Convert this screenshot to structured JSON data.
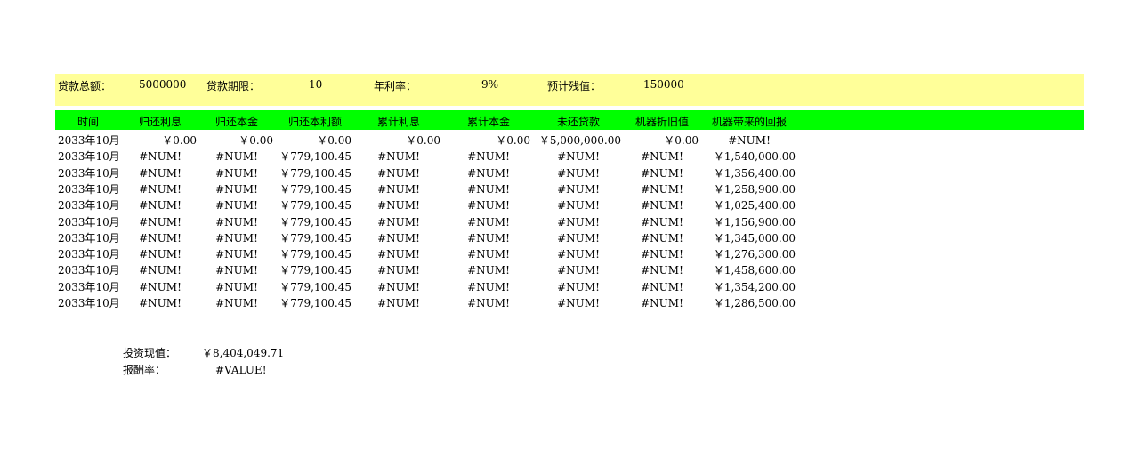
{
  "params": {
    "loan_total_label": "贷款总额：",
    "loan_total_value": "5000000",
    "loan_term_label": "贷款期限：",
    "loan_term_value": "10",
    "rate_label": "年利率：",
    "rate_value": "9%",
    "residual_label": "预计残值：",
    "residual_value": "150000"
  },
  "table": {
    "headers": [
      "时间",
      "归还利息",
      "归还本金",
      "归还本利额",
      "累计利息",
      "累计本金",
      "未还贷款",
      "机器折旧值",
      "机器带来的回报"
    ],
    "rows": [
      [
        "2033年10月",
        "￥0.00",
        "￥0.00",
        "￥0.00",
        "￥0.00",
        "￥0.00",
        "￥5,000,000.00",
        "￥0.00",
        "#NUM!"
      ],
      [
        "2033年10月",
        "#NUM!",
        "#NUM!",
        "￥779,100.45",
        "#NUM!",
        "#NUM!",
        "#NUM!",
        "#NUM!",
        "￥1,540,000.00"
      ],
      [
        "2033年10月",
        "#NUM!",
        "#NUM!",
        "￥779,100.45",
        "#NUM!",
        "#NUM!",
        "#NUM!",
        "#NUM!",
        "￥1,356,400.00"
      ],
      [
        "2033年10月",
        "#NUM!",
        "#NUM!",
        "￥779,100.45",
        "#NUM!",
        "#NUM!",
        "#NUM!",
        "#NUM!",
        "￥1,258,900.00"
      ],
      [
        "2033年10月",
        "#NUM!",
        "#NUM!",
        "￥779,100.45",
        "#NUM!",
        "#NUM!",
        "#NUM!",
        "#NUM!",
        "￥1,025,400.00"
      ],
      [
        "2033年10月",
        "#NUM!",
        "#NUM!",
        "￥779,100.45",
        "#NUM!",
        "#NUM!",
        "#NUM!",
        "#NUM!",
        "￥1,156,900.00"
      ],
      [
        "2033年10月",
        "#NUM!",
        "#NUM!",
        "￥779,100.45",
        "#NUM!",
        "#NUM!",
        "#NUM!",
        "#NUM!",
        "￥1,345,000.00"
      ],
      [
        "2033年10月",
        "#NUM!",
        "#NUM!",
        "￥779,100.45",
        "#NUM!",
        "#NUM!",
        "#NUM!",
        "#NUM!",
        "￥1,276,300.00"
      ],
      [
        "2033年10月",
        "#NUM!",
        "#NUM!",
        "￥779,100.45",
        "#NUM!",
        "#NUM!",
        "#NUM!",
        "#NUM!",
        "￥1,458,600.00"
      ],
      [
        "2033年10月",
        "#NUM!",
        "#NUM!",
        "￥779,100.45",
        "#NUM!",
        "#NUM!",
        "#NUM!",
        "#NUM!",
        "￥1,354,200.00"
      ],
      [
        "2033年10月",
        "#NUM!",
        "#NUM!",
        "￥779,100.45",
        "#NUM!",
        "#NUM!",
        "#NUM!",
        "#NUM!",
        "￥1,286,500.00"
      ]
    ]
  },
  "summary": {
    "npv_label": "投资现值：",
    "npv_value": "￥8,404,049.71",
    "irr_label": "报酬率：",
    "irr_value": "#VALUE!"
  },
  "colors": {
    "params_band": "#ffff99",
    "header_band": "#00ff00"
  }
}
